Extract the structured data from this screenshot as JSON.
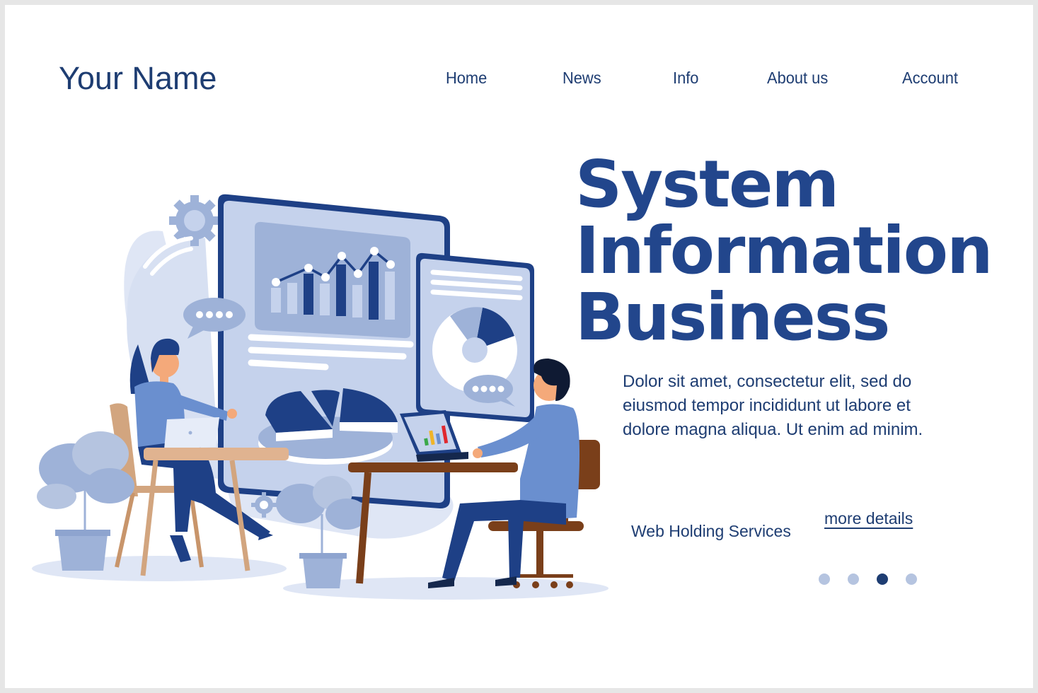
{
  "header": {
    "brand": "Your Name",
    "nav": [
      {
        "label": "Home"
      },
      {
        "label": "News"
      },
      {
        "label": "Info"
      },
      {
        "label": "About us"
      },
      {
        "label": "Account"
      }
    ]
  },
  "hero": {
    "headline": [
      "System",
      "Information",
      "Business"
    ],
    "description": "Dolor sit amet, consectetur  elit, sed do eiusmod tempor incididunt ut labore et dolore magna aliqua. Ut enim ad minim.",
    "services_label": "Web Holding Services",
    "more_link": "more details",
    "carousel": {
      "total": 4,
      "active_index": 2
    }
  },
  "illustration": {
    "description": "Two people working at desks in front of large dashboard screens showing bar/line chart and pie charts",
    "icons": [
      "gear-icon",
      "chat-bubble-icon",
      "bar-chart-icon",
      "pie-chart-icon",
      "laptop-icon",
      "plant-icon"
    ]
  },
  "colors": {
    "primary": "#1e3d72",
    "headline": "#22468c",
    "light_blue": "#c5d2ec",
    "mid_blue": "#9eb2d8",
    "accent_blue": "#6a8fcf",
    "dot_inactive": "#b5c4e0",
    "dot_active": "#1e3d72"
  }
}
